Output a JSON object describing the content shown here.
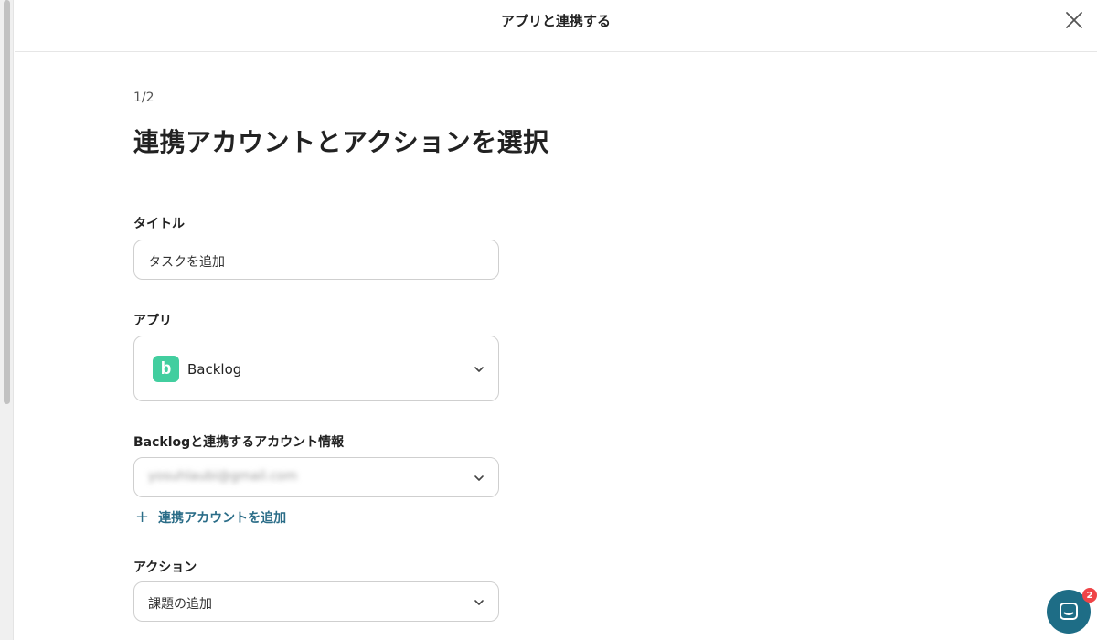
{
  "header": {
    "title": "アプリと連携する"
  },
  "step": "1/2",
  "page_title": "連携アカウントとアクションを選択",
  "fields": {
    "title": {
      "label": "タイトル",
      "value": "タスクを追加"
    },
    "app": {
      "label": "アプリ",
      "value": "Backlog",
      "logo_letter": "b",
      "logo_color": "#42ce9f"
    },
    "account": {
      "label": "Backlogと連携するアカウント情報",
      "value": "yosuhlaubi@gmail.com"
    },
    "add_account": "連携アカウントを追加",
    "action": {
      "label": "アクション",
      "value": "課題の追加"
    }
  },
  "chat": {
    "badge_count": "2"
  },
  "colors": {
    "accent": "#2b6d88",
    "chat": "#1e6d86",
    "badge": "#ef4447"
  }
}
